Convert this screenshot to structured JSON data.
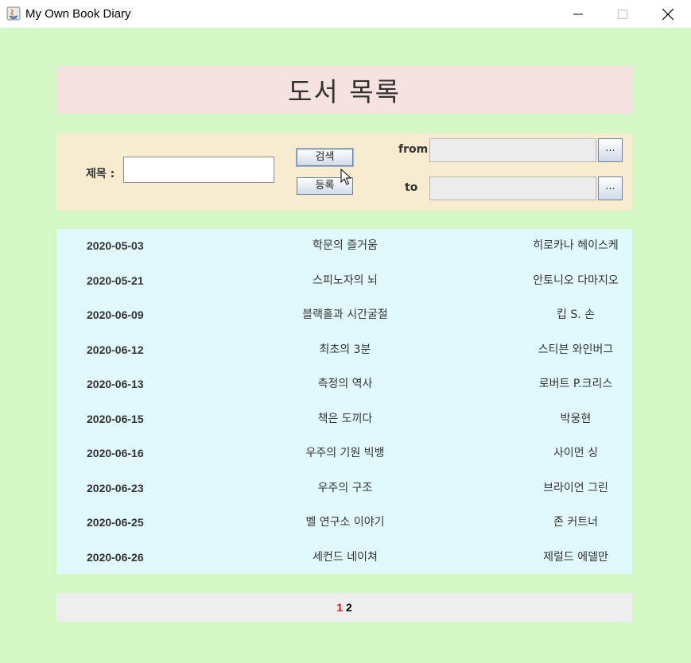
{
  "window": {
    "title": "My Own Book Diary",
    "minimize_glyph": "–",
    "close_glyph": "✕"
  },
  "heading": {
    "text": "도서 목록"
  },
  "search": {
    "title_label": "제목 :",
    "title_value": "",
    "search_button": "검색",
    "register_button": "등록",
    "from_label": "from",
    "from_value": "",
    "to_label": "to",
    "to_value": "",
    "picker_label": "..."
  },
  "books": [
    {
      "date": "2020-05-03",
      "title": "학문의 즐거움",
      "author": "히로카나 헤이스케"
    },
    {
      "date": "2020-05-21",
      "title": "스피노자의 뇌",
      "author": "안토니오 다마지오"
    },
    {
      "date": "2020-06-09",
      "title": "블랙홀과 시간굴절",
      "author": "킵 S. 손"
    },
    {
      "date": "2020-06-12",
      "title": "최초의 3분",
      "author": "스티븐 와인버그"
    },
    {
      "date": "2020-06-13",
      "title": "측정의 역사",
      "author": "로버트 P.크리스"
    },
    {
      "date": "2020-06-15",
      "title": "책은 도끼다",
      "author": "박웅현"
    },
    {
      "date": "2020-06-16",
      "title": "우주의 기원 빅뱅",
      "author": "사이먼 싱"
    },
    {
      "date": "2020-06-23",
      "title": "우주의 구조",
      "author": "브라이언 그린"
    },
    {
      "date": "2020-06-25",
      "title": "벨 연구소 이야기",
      "author": "존 커트너"
    },
    {
      "date": "2020-06-26",
      "title": "세컨드 네이쳐",
      "author": "제럴드 에델만"
    }
  ],
  "pagination": {
    "current": "1",
    "other": "2"
  },
  "colors": {
    "background": "#d4f7c6",
    "heading_bg": "#f7e2e2",
    "search_bg": "#f7ecd0",
    "list_bg": "#e1f8fc",
    "pager_bg": "#eeeeee",
    "current_page": "#e01414"
  },
  "icons": [
    "java-app-icon",
    "minimize-icon",
    "maximize-icon",
    "close-icon",
    "mouse-cursor-icon"
  ]
}
